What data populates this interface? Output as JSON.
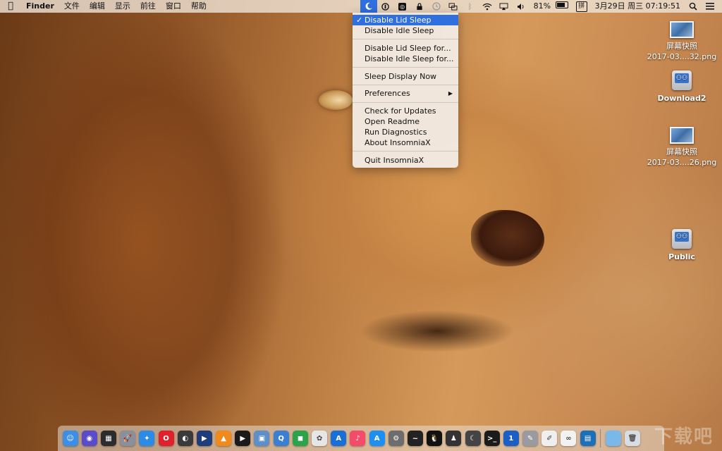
{
  "menubar": {
    "apple_icon": "apple-logo-icon",
    "app_name": "Finder",
    "items": [
      "文件",
      "编辑",
      "显示",
      "前往",
      "窗口",
      "帮助"
    ],
    "battery": "81%",
    "battery_level": 0.81,
    "ime_label": "拼",
    "datetime": "3月29日 周三  07:19:51"
  },
  "dropdown": {
    "items": [
      {
        "label": "Disable Lid Sleep",
        "checked": true,
        "selected": true
      },
      {
        "label": "Disable Idle Sleep"
      },
      {
        "label": "Disable Lid Sleep for..."
      },
      {
        "label": "Disable Idle Sleep for..."
      },
      {
        "label": "Sleep Display Now"
      },
      {
        "label": "Preferences",
        "submenu": true
      },
      {
        "label": "Check for Updates"
      },
      {
        "label": "Open Readme"
      },
      {
        "label": "Run Diagnostics"
      },
      {
        "label": "About InsomniaX"
      },
      {
        "label": "Quit InsomniaX"
      }
    ],
    "check_mark": "✓",
    "submenu_arrow": "▶"
  },
  "desktop_icons": [
    {
      "line1": "屏幕快照",
      "line2": "2017-03....32.png",
      "kind": "screenshot"
    },
    {
      "line1": "Download2",
      "kind": "network-drive"
    },
    {
      "line1": "屏幕快照",
      "line2": "2017-03....26.png",
      "kind": "screenshot"
    },
    {
      "line1": "Public",
      "kind": "network-drive"
    }
  ],
  "dock": {
    "apps": [
      {
        "name": "finder",
        "color": "#3c8ee6",
        "glyph": "☺"
      },
      {
        "name": "siri",
        "color": "#5a4cc8",
        "glyph": "◉"
      },
      {
        "name": "dashboard",
        "color": "#2c2c2c",
        "glyph": "▦"
      },
      {
        "name": "launchpad",
        "color": "#8a8f99",
        "glyph": "🚀"
      },
      {
        "name": "safari",
        "color": "#2b8be6",
        "glyph": "✦"
      },
      {
        "name": "opera",
        "color": "#e0202a",
        "glyph": "O"
      },
      {
        "name": "chrome-like",
        "color": "#3a3a3a",
        "glyph": "◐"
      },
      {
        "name": "quicktime",
        "color": "#1f3d7a",
        "glyph": "▶"
      },
      {
        "name": "vlc",
        "color": "#f08a1c",
        "glyph": "▲"
      },
      {
        "name": "player",
        "color": "#1a1a1a",
        "glyph": "▶"
      },
      {
        "name": "preview",
        "color": "#5e8fc8",
        "glyph": "▣"
      },
      {
        "name": "messages-q",
        "color": "#3c7fd0",
        "glyph": "Q"
      },
      {
        "name": "facetime",
        "color": "#2aa34a",
        "glyph": "◼"
      },
      {
        "name": "photos",
        "color": "#e6e6e6",
        "glyph": "✿"
      },
      {
        "name": "xcode",
        "color": "#1a6fd6",
        "glyph": "A"
      },
      {
        "name": "music",
        "color": "#f44b6a",
        "glyph": "♪"
      },
      {
        "name": "app-store",
        "color": "#1d8ff0",
        "glyph": "A"
      },
      {
        "name": "system-prefs",
        "color": "#6d6d6d",
        "glyph": "⚙"
      },
      {
        "name": "activity-monitor",
        "color": "#222222",
        "glyph": "~"
      },
      {
        "name": "qq",
        "color": "#111111",
        "glyph": "🐧"
      },
      {
        "name": "incognito",
        "color": "#333333",
        "glyph": "♟"
      },
      {
        "name": "night",
        "color": "#444444",
        "glyph": "☾"
      },
      {
        "name": "terminal",
        "color": "#1b1b1b",
        "glyph": ">_"
      },
      {
        "name": "onepassword",
        "color": "#1b5ec4",
        "glyph": "1"
      },
      {
        "name": "utility",
        "color": "#9a9aa0",
        "glyph": "✎"
      },
      {
        "name": "textedit",
        "color": "#efefef",
        "glyph": "✐"
      },
      {
        "name": "baidu",
        "color": "#f2f2f2",
        "glyph": "∞"
      },
      {
        "name": "screen-capture",
        "color": "#1d6fb8",
        "glyph": "▤"
      }
    ],
    "folder_color": "#7ab8ea",
    "trash_glyph": "🗑"
  },
  "watermark": "下载吧"
}
